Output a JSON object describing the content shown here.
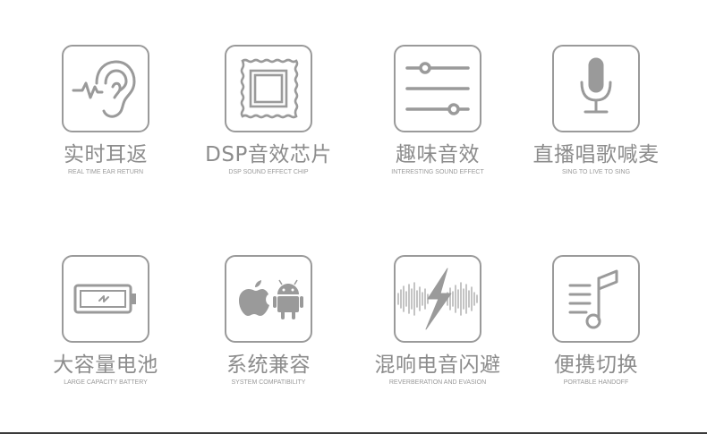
{
  "features": [
    {
      "title": "实时耳返",
      "subtitle": "REAL TIME EAR RETURN",
      "icon": "ear-icon"
    },
    {
      "title": "DSP音效芯片",
      "subtitle": "DSP  SOUND EFFECT CHIP",
      "icon": "chip-icon"
    },
    {
      "title": "趣味音效",
      "subtitle": "INTERESTING SOUND EFFECT",
      "icon": "sliders-icon"
    },
    {
      "title": "直播唱歌喊麦",
      "subtitle": "SING TO LIVE TO SING",
      "icon": "microphone-icon"
    },
    {
      "title": "大容量电池",
      "subtitle": "LARGE CAPACITY BATTERY",
      "icon": "battery-icon"
    },
    {
      "title": "系统兼容",
      "subtitle": "SYSTEM COMPATIBILITY",
      "icon": "apple-android-icon"
    },
    {
      "title": "混响电音闪避",
      "subtitle": "REVERBERATION AND EVASION",
      "icon": "lightning-waveform-icon"
    },
    {
      "title": "便携切换",
      "subtitle": "PORTABLE HANDOFF",
      "icon": "music-note-icon"
    }
  ],
  "colors": {
    "icon_stroke": "#9a9a9a",
    "title": "#8c8c8c",
    "background": "#ffffff"
  }
}
